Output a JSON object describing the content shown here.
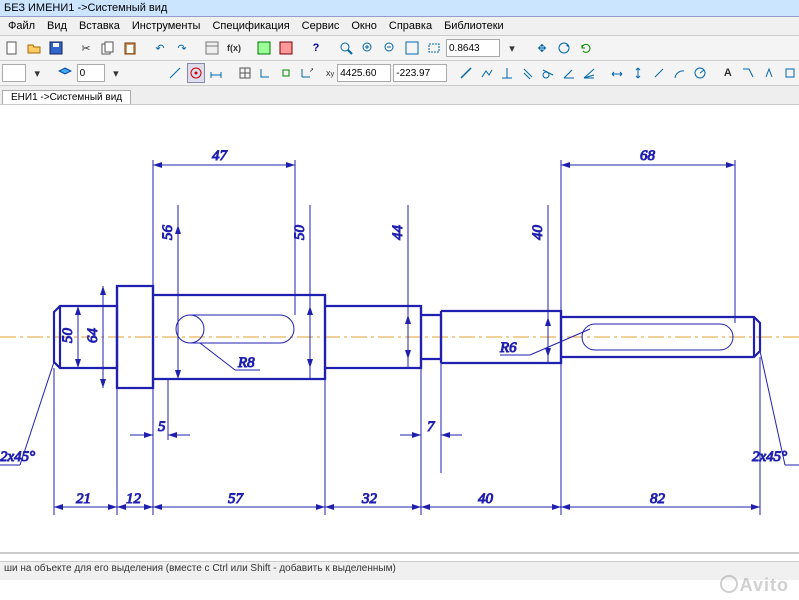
{
  "window": {
    "title": "БЕЗ ИМЕНИ1 ->Системный вид"
  },
  "menu": {
    "file": "Файл",
    "view": "Вид",
    "insert": "Вставка",
    "tools": "Инструменты",
    "spec": "Спецификация",
    "service": "Сервис",
    "window": "Окно",
    "help": "Справка",
    "libs": "Библиотеки"
  },
  "toolbar2": {
    "zoom_value": "0.8643"
  },
  "toolbar3": {
    "layer_index": "0",
    "coord_x": "4425.60",
    "coord_y": "-223.97"
  },
  "tabs": {
    "active": "ЕНИ1 ->Системный вид"
  },
  "status": {
    "hint": "ши на объекте для его выделения (вместе с Ctrl или Shift - добавить к выделенным)"
  },
  "watermark": {
    "text": "Avito"
  },
  "drawing": {
    "dims": {
      "top_47": "47",
      "top_68": "68",
      "v_56": "56",
      "v_50r": "50",
      "v_44": "44",
      "v_40": "40",
      "v_50l": "50",
      "v_64": "64",
      "r8": "R8",
      "r6": "R6",
      "gap_5": "5",
      "gap_7": "7",
      "chamfer_l": "2x45°",
      "chamfer_r": "2x45°",
      "b_21": "21",
      "b_12": "12",
      "b_57": "57",
      "b_32": "32",
      "b_40": "40",
      "b_82": "82"
    }
  }
}
